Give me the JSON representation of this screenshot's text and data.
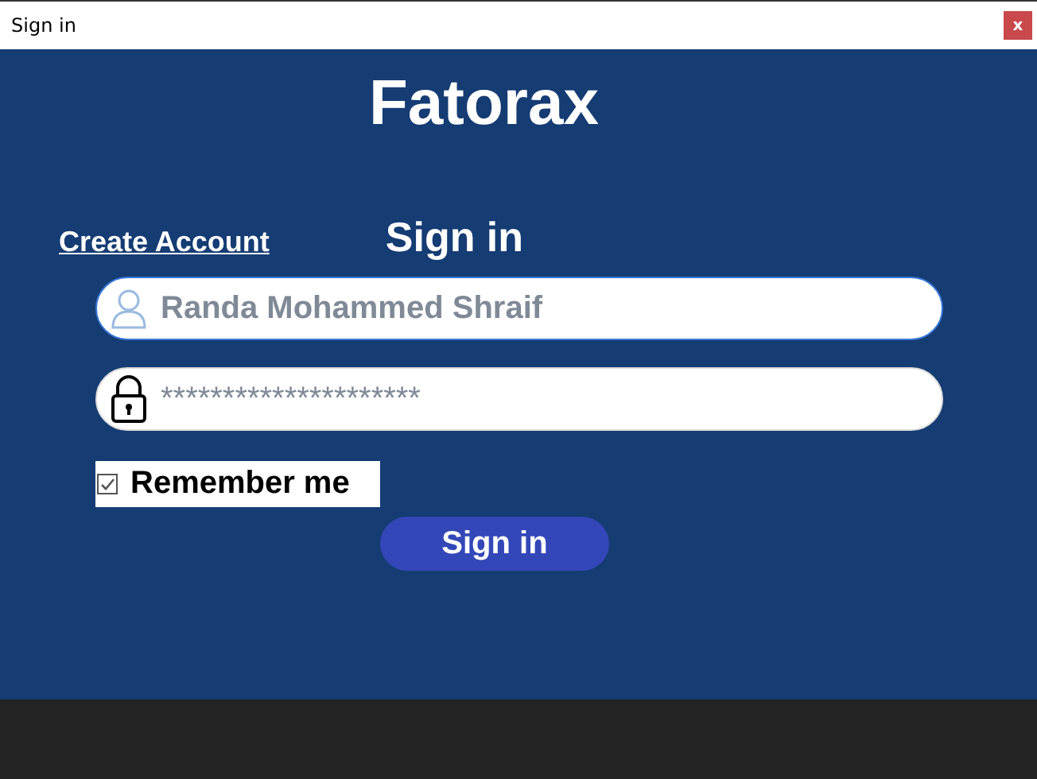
{
  "window": {
    "title": "Sign in",
    "close": "x"
  },
  "app_title": "Fatorax",
  "create_account": "Create Account",
  "heading": "Sign in",
  "fields": [
    {
      "kind": "user",
      "value": "Randa Mohammed Shraif",
      "focused": true
    },
    {
      "kind": "lock",
      "value": "*********************",
      "focused": false
    }
  ],
  "remember": {
    "label": "Remember me",
    "checked": true
  },
  "button": "Sign in"
}
